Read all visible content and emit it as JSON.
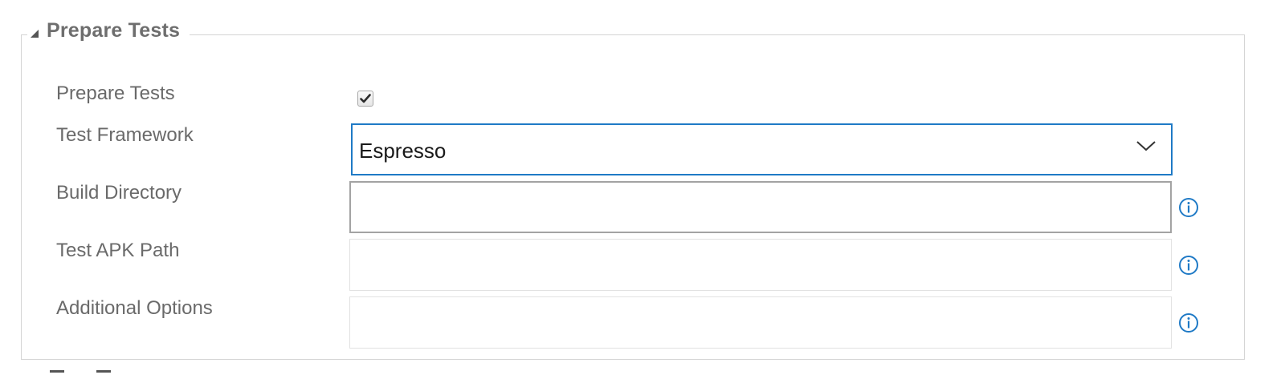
{
  "section": {
    "title": "Prepare Tests",
    "expanded": true
  },
  "fields": {
    "prepare_tests": {
      "label": "Prepare Tests",
      "checked": true
    },
    "test_framework": {
      "label": "Test Framework",
      "value": "Espresso"
    },
    "build_directory": {
      "label": "Build Directory",
      "value": "",
      "info_icon": "info-icon"
    },
    "test_apk_path": {
      "label": "Test APK Path",
      "value": "",
      "info_icon": "info-icon"
    },
    "additional_options": {
      "label": "Additional Options",
      "value": "",
      "info_icon": "info-icon"
    }
  },
  "colors": {
    "accent_blue": "#1f7ac6",
    "label_gray": "#6a6a6a",
    "border_gray": "#d4d4d4"
  }
}
